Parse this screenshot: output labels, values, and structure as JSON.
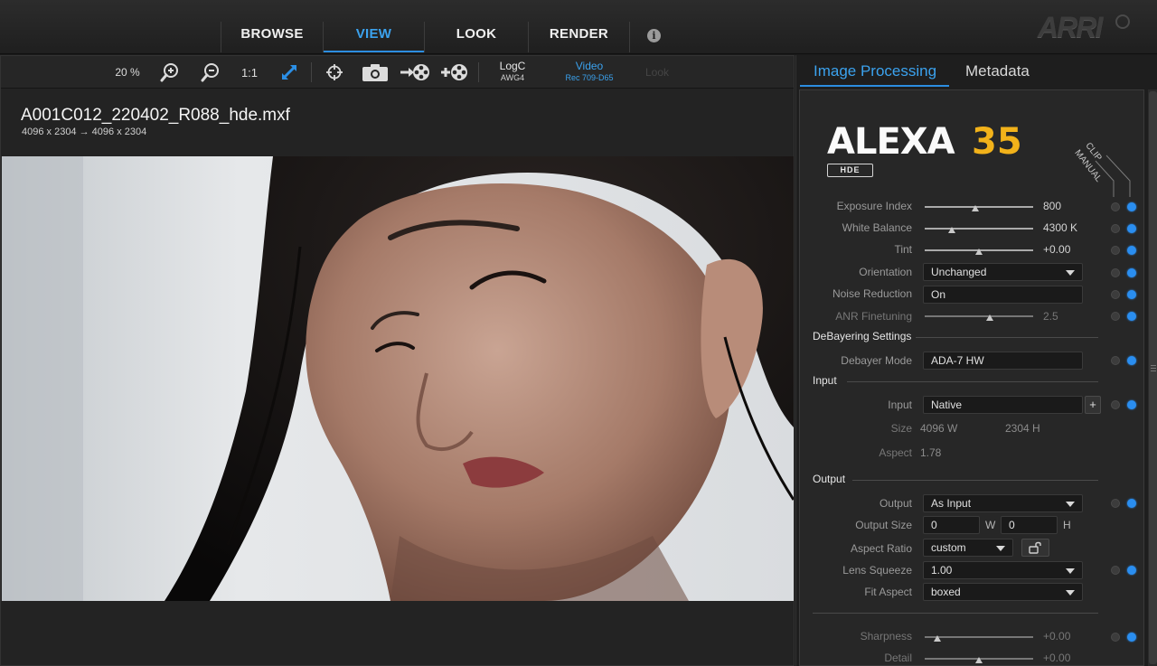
{
  "nav": {
    "tabs": [
      {
        "label": "BROWSE"
      },
      {
        "label": "VIEW"
      },
      {
        "label": "LOOK"
      },
      {
        "label": "RENDER"
      }
    ],
    "active_tab": "VIEW",
    "info_glyph": "i",
    "brand_logo": "ARRI"
  },
  "toolbar": {
    "zoom": "20 %",
    "ratio_label": "1:1",
    "log_mode": "LogC",
    "log_sub": "AWG4",
    "video_mode": "Video",
    "video_sub": "Rec 709-D65",
    "look_label": "Look",
    "icons": [
      "zoom-in-icon",
      "zoom-out-icon",
      "fit-to-window-icon",
      "crosshair-icon",
      "camera-snapshot-icon",
      "export-reel-icon",
      "add-reel-icon"
    ]
  },
  "clip": {
    "filename": "A001C012_220402_R088_hde.mxf",
    "resolution": "4096 x 2304  → 4096 x 2304"
  },
  "panel": {
    "tabs": [
      {
        "label": "Image Processing"
      },
      {
        "label": "Metadata"
      }
    ],
    "active_tab": "Image Processing",
    "brand_model": "ALEXA",
    "brand_number": "35",
    "codec_badge": "HDE",
    "column_clip": "CLIP",
    "column_manual": "MANUAL",
    "accent_color": "#2a8ef0",
    "brand_number_color": "#f2b21a",
    "rows": {
      "exposure_index": {
        "label": "Exposure Index",
        "value": "800",
        "level": 0.47
      },
      "white_balance": {
        "label": "White Balance",
        "value": "4300 K",
        "level": 0.25
      },
      "tint": {
        "label": "Tint",
        "value": "+0.00",
        "level": 0.5
      },
      "orientation": {
        "label": "Orientation",
        "value": "Unchanged"
      },
      "noise_reduction": {
        "label": "Noise Reduction",
        "value": "On"
      },
      "anr_finetuning": {
        "label": "ANR Finetuning",
        "value": "2.5",
        "level": 0.6
      },
      "debayer_mode": {
        "label": "Debayer Mode",
        "value": "ADA-7 HW"
      },
      "input": {
        "label": "Input",
        "value": "Native",
        "add": "+"
      },
      "size": {
        "label": "Size",
        "width": "4096 W",
        "height": "2304 H"
      },
      "aspect": {
        "label": "Aspect",
        "value": "1.78"
      },
      "output": {
        "label": "Output",
        "value": "As Input"
      },
      "output_size": {
        "label": "Output Size",
        "width": "0",
        "w_unit": "W",
        "height": "0",
        "h_unit": "H"
      },
      "aspect_ratio": {
        "label": "Aspect Ratio",
        "value": "custom"
      },
      "lens_squeeze": {
        "label": "Lens Squeeze",
        "value": "1.00"
      },
      "fit_aspect": {
        "label": "Fit Aspect",
        "value": "boxed"
      },
      "sharpness": {
        "label": "Sharpness",
        "value": "+0.00",
        "level": 0.12
      },
      "detail": {
        "label": "Detail",
        "value": "+0.00",
        "level": 0.5
      }
    },
    "sections": {
      "debayering": "DeBayering Settings",
      "input": "Input",
      "output": "Output"
    }
  }
}
